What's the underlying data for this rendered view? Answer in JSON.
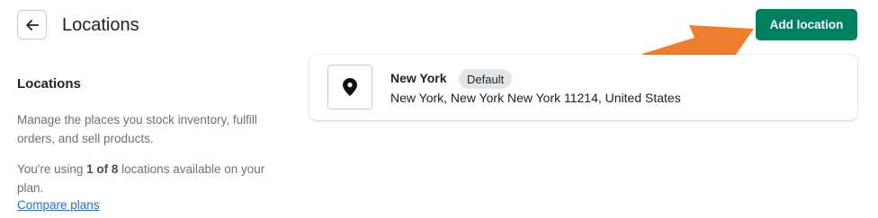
{
  "header": {
    "title": "Locations",
    "add_button_label": "Add location"
  },
  "aside": {
    "heading": "Locations",
    "description": "Manage the places you stock inventory, fulfill orders, and sell products.",
    "usage_prefix": "You're using ",
    "usage_count": "1 of 8",
    "usage_suffix": " locations available on your plan.",
    "compare_link": "Compare plans"
  },
  "locations": [
    {
      "name": "New York",
      "badge": "Default",
      "address": "New York, New York New York 11214, United States",
      "icon": "map-pin-icon"
    }
  ],
  "colors": {
    "primary": "#008060",
    "annotation_arrow": "#ee7d2e",
    "link": "#2c6ecb"
  }
}
